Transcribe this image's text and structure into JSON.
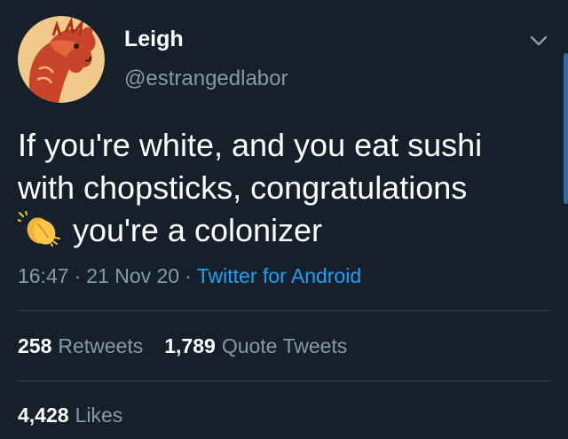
{
  "author": {
    "name": "Leigh",
    "handle": "@estrangedlabor"
  },
  "tweet": {
    "line1": "If you're white, and you eat sushi",
    "line2": "with chopsticks, congratulations",
    "line3": "you're a colonizer",
    "emoji": "clapping-hands-icon"
  },
  "meta": {
    "time": "16:47",
    "date": "21 Nov 20",
    "separator": "·",
    "source": "Twitter for Android"
  },
  "stats": {
    "retweets_count": "258",
    "retweets_label": "Retweets",
    "quotes_count": "1,789",
    "quotes_label": "Quote Tweets",
    "likes_count": "4,428",
    "likes_label": "Likes"
  },
  "colors": {
    "background": "#15202b",
    "secondary_text": "#8899a6",
    "link": "#1da1f2",
    "divider": "#38444d"
  }
}
